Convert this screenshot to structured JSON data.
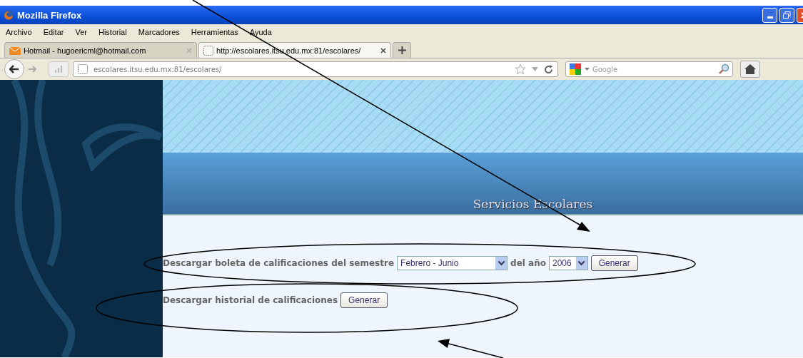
{
  "window": {
    "title": "Mozilla Firefox"
  },
  "menu": [
    "Archivo",
    "Editar",
    "Ver",
    "Historial",
    "Marcadores",
    "Herramientas",
    "Ayuda"
  ],
  "tabs": [
    {
      "label": "Hotmail - hugoericml@hotmail.com",
      "selected": false
    },
    {
      "label": "http://escolares.itsu.edu.mx:81/escolares/",
      "selected": true
    }
  ],
  "address": {
    "value": "escolares.itsu.edu.mx:81/escolares/"
  },
  "search": {
    "placeholder": "Google"
  },
  "page": {
    "heading": "Servicios Escolares",
    "rows": [
      {
        "kind": "semester",
        "label": "Descargar boleta de calificaciones del semestre",
        "semester": "Febrero - Junio",
        "year_label": "del año",
        "year": "2006",
        "button": "Generar"
      },
      {
        "kind": "history",
        "label": "Descargar historial de calificaciones",
        "button": "Generar"
      }
    ]
  }
}
